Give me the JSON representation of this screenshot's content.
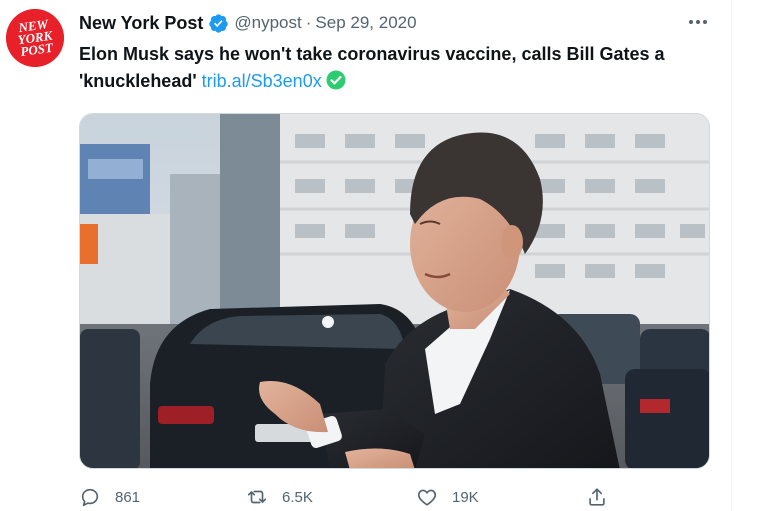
{
  "tweet": {
    "author": {
      "name": "New York Post",
      "handle": "@nypost",
      "avatar_text": [
        "NEW",
        "YORK",
        "POST"
      ],
      "avatar_color": "#e8202a",
      "verified": true
    },
    "separator": "·",
    "timestamp": "Sep 29, 2020",
    "text": {
      "main": "Elon Musk says he won't take coronavirus vaccine, calls Bill Gates a",
      "quote_open": "'",
      "emphasis": "knucklehead",
      "quote_close": "'",
      "link": "trib.al/Sb3en0x",
      "emoji": "check-mark-button"
    },
    "media": {
      "kind": "photo"
    },
    "actions": {
      "reply_count": "861",
      "retweet_count": "6.5K",
      "like_count": "19K"
    }
  },
  "colors": {
    "text_primary": "#0f1419",
    "text_secondary": "#536471",
    "link": "#1d9bf0",
    "verified_badge": "#1d9bf0",
    "emoji_check": "#2ecc71"
  }
}
